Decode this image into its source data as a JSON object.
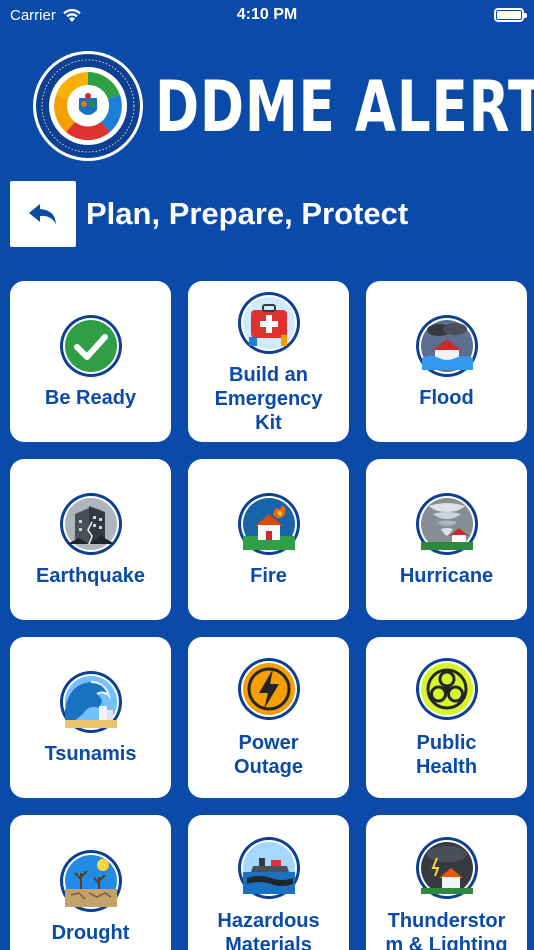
{
  "status_bar": {
    "carrier": "Carrier",
    "time": "4:10 PM"
  },
  "header": {
    "title": "DDME ALERT",
    "seal_icon": "ddme-seal-icon"
  },
  "page": {
    "back_icon": "back-arrow-icon",
    "title": "Plan, Prepare, Protect"
  },
  "colors": {
    "brand_blue": "#0a4aa8",
    "tile_bg": "#ffffff",
    "ring_blue": "#0d3f93"
  },
  "tiles": [
    {
      "label_lines": [
        "Be Ready"
      ],
      "icon": "checkmark-icon"
    },
    {
      "label_lines": [
        "Build an",
        "Emergency",
        "Kit"
      ],
      "icon": "first-aid-kit-icon"
    },
    {
      "label_lines": [
        "Flood"
      ],
      "icon": "flood-icon"
    },
    {
      "label_lines": [
        "Earthquake"
      ],
      "icon": "earthquake-icon"
    },
    {
      "label_lines": [
        "Fire"
      ],
      "icon": "fire-icon"
    },
    {
      "label_lines": [
        "Hurricane"
      ],
      "icon": "hurricane-icon"
    },
    {
      "label_lines": [
        "Tsunamis"
      ],
      "icon": "tsunami-icon"
    },
    {
      "label_lines": [
        "Power",
        "Outage"
      ],
      "icon": "lightning-bolt-icon"
    },
    {
      "label_lines": [
        "Public",
        "Health"
      ],
      "icon": "biohazard-icon"
    },
    {
      "label_lines": [
        "Drought"
      ],
      "icon": "drought-icon"
    },
    {
      "label_lines": [
        "Hazardous",
        "Materials"
      ],
      "icon": "hazardous-materials-icon"
    },
    {
      "label_lines": [
        "Thunderstor",
        "m & Lighting"
      ],
      "icon": "thunderstorm-icon"
    }
  ]
}
